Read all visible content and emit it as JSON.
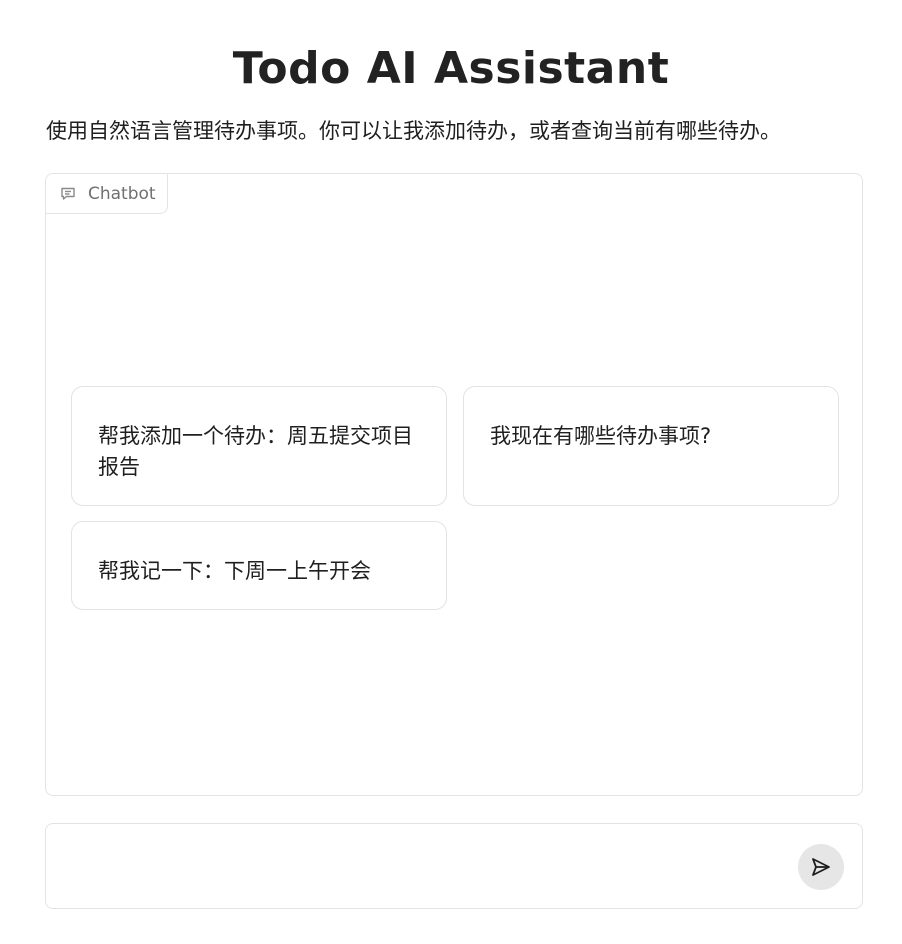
{
  "header": {
    "title": "Todo AI Assistant",
    "description": "使用自然语言管理待办事项。你可以让我添加待办，或者查询当前有哪些待办。"
  },
  "chatbot": {
    "label": "Chatbot",
    "label_icon": "chat-bubble-icon",
    "examples": [
      {
        "text": "帮我添加一个待办：周五提交项目报告"
      },
      {
        "text": "我现在有哪些待办事项?"
      },
      {
        "text": "帮我记一下：下周一上午开会"
      }
    ]
  },
  "input": {
    "placeholder": "",
    "value": "",
    "send_icon": "send-icon"
  },
  "colors": {
    "border": "#e3e3e3",
    "send_button_bg": "#e6e6e6",
    "text": "#1f1f1f",
    "muted": "#707070"
  }
}
